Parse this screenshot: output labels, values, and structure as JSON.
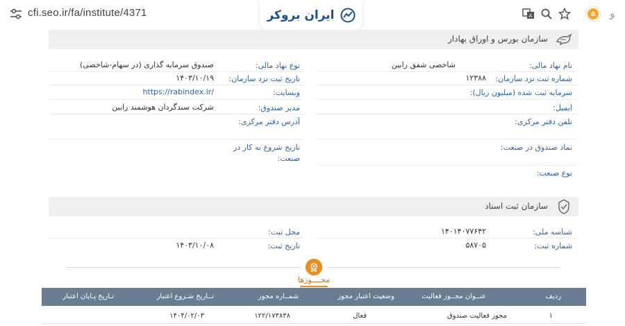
{
  "browser": {
    "url": "cfi.seo.ir/fa/institute/4371",
    "logo_text": "ایران بروکر",
    "ext_letter": "a",
    "edge_char": "و"
  },
  "seo_section": {
    "title": "سازمان بورس و اوراق بهادار",
    "right_fields": [
      {
        "label": "نام نهاد مالی:",
        "value": "شاخصی شفق رابین"
      },
      {
        "label": "شماره ثبت نزد سازمان:",
        "value": "۱۲۳۸۸"
      },
      {
        "label": "سرمایه ثبت شده (میلیون ریال):",
        "value": ""
      },
      {
        "label": "ایمیل:",
        "value": ""
      },
      {
        "label": "تلفن دفتر مرکزی:",
        "value": ""
      },
      {
        "label": "نماد صندوق در صنعت:",
        "value": ""
      },
      {
        "label": "نوع صنعت:",
        "value": ""
      }
    ],
    "left_fields": [
      {
        "label": "نوع نهاد مالی:",
        "value": "صندوق سرمایه گذاری (در سهام-شاخصی)"
      },
      {
        "label": "تاریخ ثبت نزد سازمان:",
        "value": "۱۴۰۳/۱۰/۱۹"
      },
      {
        "label": "وبسایت:",
        "value": "https://rabindex.ir/"
      },
      {
        "label": "مدیر صندوق:",
        "value": "شرکت سبدگردان هوشمند رابین"
      },
      {
        "label": "آدرس دفتر مرکزی:",
        "value": ""
      },
      {
        "label_line1": "تاریخ شروع به کار در",
        "label_line2": "صنعت:",
        "value": ""
      }
    ]
  },
  "registry_section": {
    "title": "سازمان ثبت اسناد",
    "right_fields": [
      {
        "label": "شناسه ملی:",
        "value": "۱۴۰۱۴۰۷۷۶۴۲"
      },
      {
        "label": "شماره ثبت:",
        "value": "۵۸۷۰۵"
      }
    ],
    "left_fields": [
      {
        "label": "محل ثبت:",
        "value": ""
      },
      {
        "label": "تاریخ ثبت:",
        "value": "۱۴۰۳/۱۰/۰۸"
      }
    ]
  },
  "licenses": {
    "title": "مجــــوزها",
    "columns": [
      "ردیف",
      "عنــوان مجــوز فعالیت",
      "وضعیت اعتبار مجوز",
      "شمــاره مجوز",
      "تــاریخ شـروع اعتبار",
      "تـاریخ پـایان اعتبار"
    ],
    "rows": [
      [
        "۱",
        "مجوز فعالیت صندوق",
        "فعال",
        "۱۲۲/۱۷۳۸۳۸",
        "۱۴۰۴/۰۲/۰۳",
        ""
      ]
    ]
  },
  "colors": {
    "label": "#2b63b5",
    "accent": "#f08a1c",
    "table_header": "#6b7d90",
    "panel": "#efefef"
  }
}
